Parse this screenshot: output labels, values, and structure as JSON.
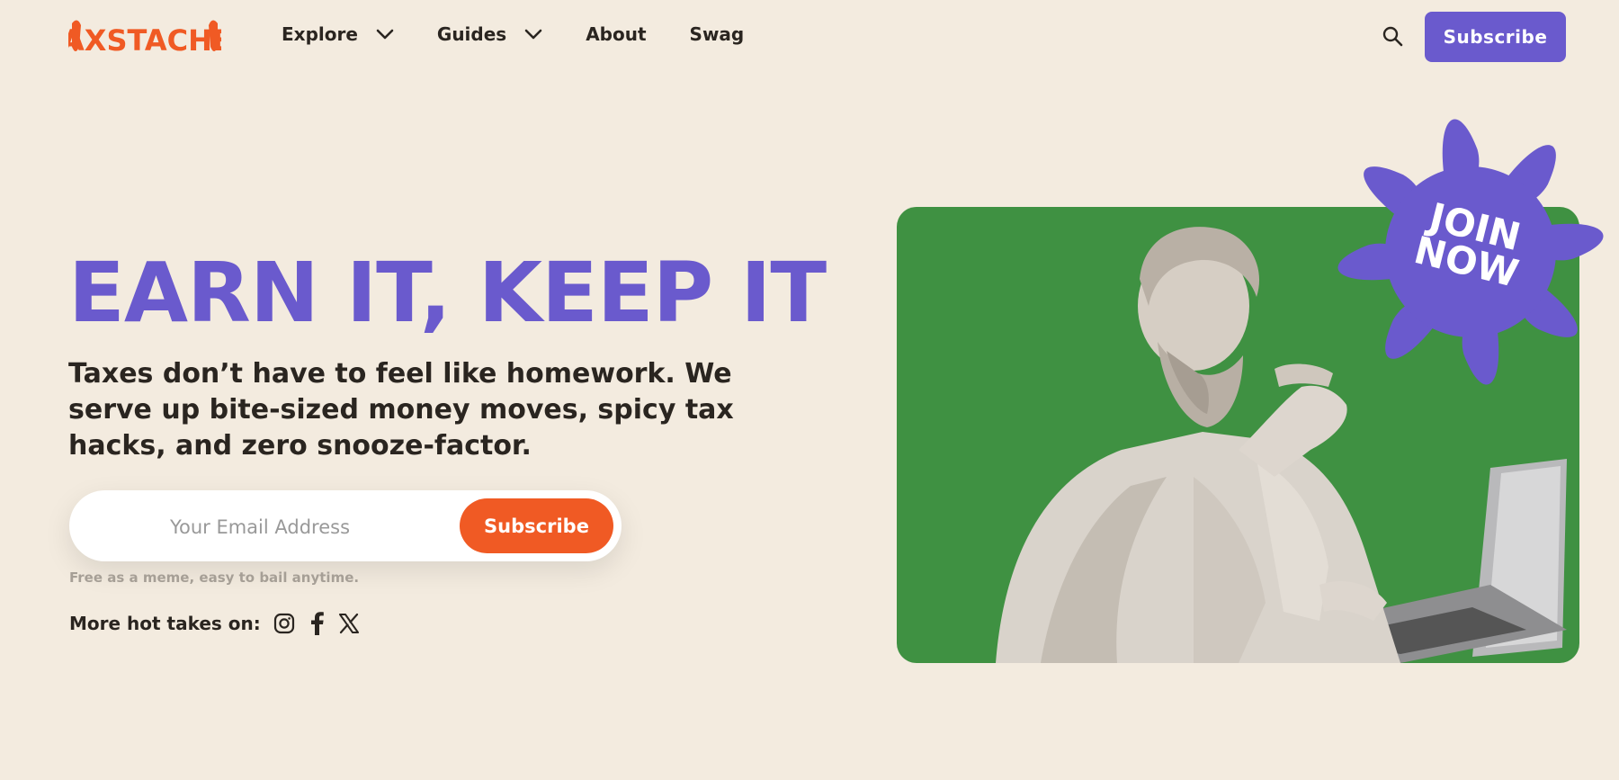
{
  "brand": {
    "logo_text": "TAXSTACHE!"
  },
  "nav": {
    "items": [
      {
        "label": "Explore",
        "has_dropdown": true
      },
      {
        "label": "Guides",
        "has_dropdown": true
      },
      {
        "label": "About",
        "has_dropdown": false
      },
      {
        "label": "Swag",
        "has_dropdown": false
      }
    ]
  },
  "header": {
    "subscribe_label": "Subscribe",
    "search_icon": "search-icon"
  },
  "hero": {
    "title": "EARN IT, KEEP IT",
    "subtitle": "Taxes don’t have to feel like homework. We serve up bite-sized money moves, spicy tax hacks, and zero snooze-factor.",
    "email_placeholder": "Your Email Address",
    "subscribe_label": "Subscribe",
    "fine_print": "Free as a meme, easy to bail anytime.",
    "social_label": "More hot takes on:",
    "social_icons": [
      "instagram-icon",
      "facebook-icon",
      "x-icon"
    ]
  },
  "badge": {
    "line1": "JOIN",
    "line2": "NOW"
  },
  "colors": {
    "background": "#f3ebdf",
    "accent_purple": "#6a5acd",
    "accent_orange": "#f05a24",
    "card_green": "#3f9142"
  }
}
